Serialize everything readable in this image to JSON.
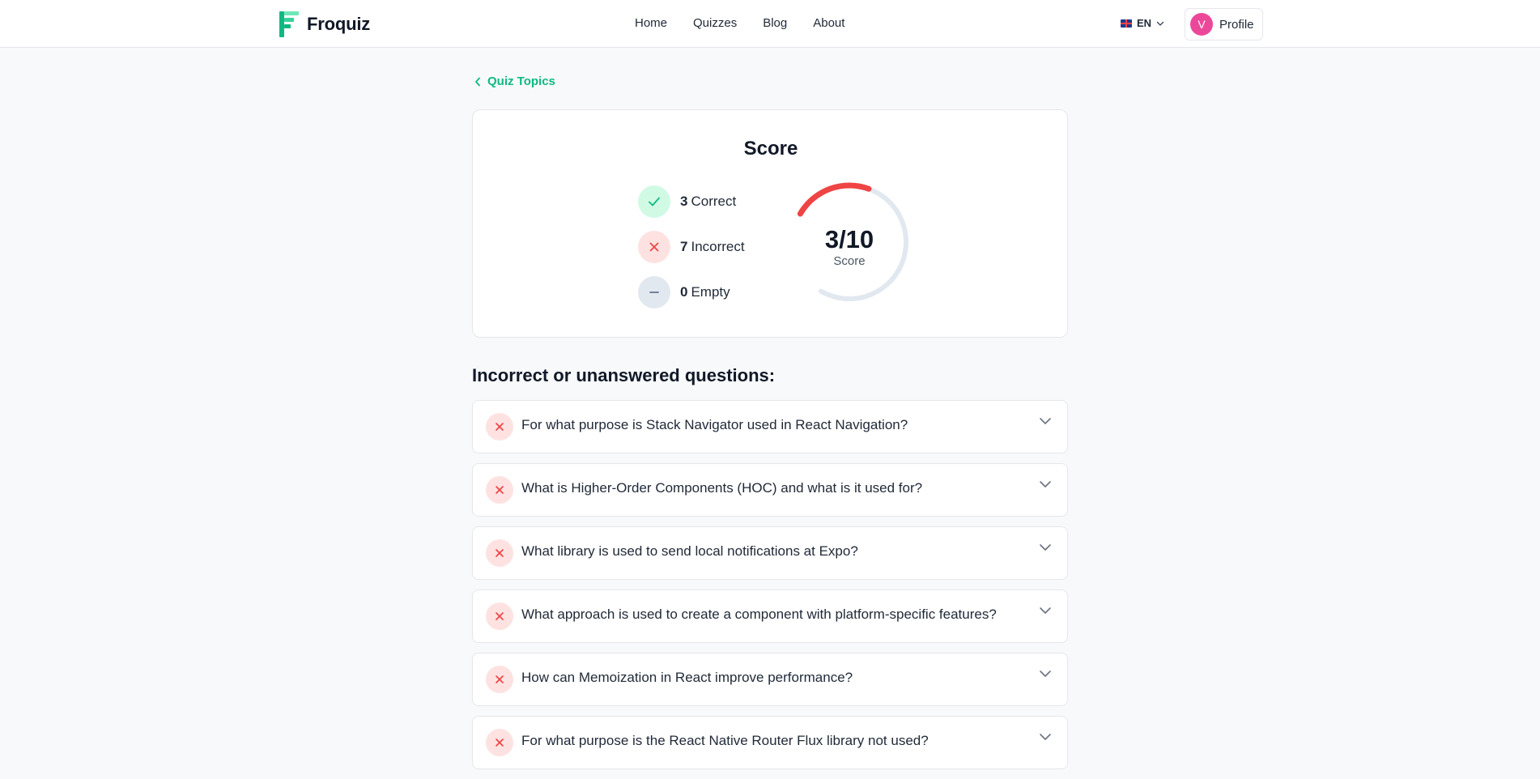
{
  "header": {
    "brand": "Froquiz",
    "nav": [
      "Home",
      "Quizzes",
      "Blog",
      "About"
    ],
    "language": "EN",
    "profile": {
      "initial": "V",
      "label": "Profile"
    }
  },
  "back_link": "Quiz Topics",
  "score": {
    "title": "Score",
    "correct": {
      "count": "3",
      "label": "Correct"
    },
    "incorrect": {
      "count": "7",
      "label": "Incorrect"
    },
    "empty": {
      "count": "0",
      "label": "Empty"
    },
    "display": "3/10",
    "caption": "Score",
    "fraction": 0.3
  },
  "section_title": "Incorrect or unanswered questions:",
  "questions": [
    "For what purpose is Stack Navigator used in React Navigation?",
    "What is Higher-Order Components (HOC) and what is it used for?",
    "What library is used to send local notifications at Expo?",
    "What approach is used to create a component with platform-specific features?",
    "How can Memoization in React improve performance?",
    "For what purpose is the React Native Router Flux library not used?"
  ],
  "colors": {
    "accent": "#10b981",
    "incorrect": "#ef4444",
    "ring_track": "#e2e8f0",
    "avatar": "#ec4899"
  }
}
